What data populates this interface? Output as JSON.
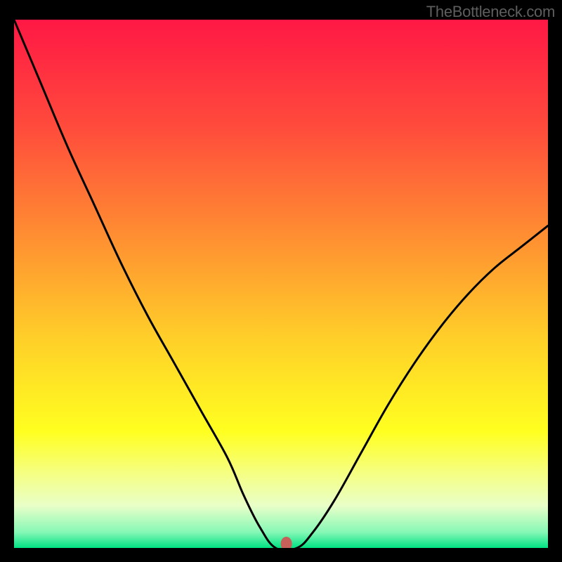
{
  "watermark": "TheBottleneck.com",
  "chart_data": {
    "type": "line",
    "title": "",
    "xlabel": "",
    "ylabel": "",
    "x": [
      0.0,
      0.05,
      0.1,
      0.15,
      0.2,
      0.25,
      0.3,
      0.35,
      0.4,
      0.43,
      0.46,
      0.49,
      0.53,
      0.56,
      0.6,
      0.65,
      0.7,
      0.75,
      0.8,
      0.85,
      0.9,
      0.95,
      1.0
    ],
    "values": [
      1.0,
      0.88,
      0.76,
      0.65,
      0.54,
      0.44,
      0.35,
      0.26,
      0.17,
      0.1,
      0.04,
      0.0,
      0.0,
      0.03,
      0.09,
      0.18,
      0.27,
      0.35,
      0.42,
      0.48,
      0.53,
      0.57,
      0.61
    ],
    "xlim": [
      0,
      1
    ],
    "ylim": [
      0,
      1
    ],
    "marker": {
      "x": 0.51,
      "y": 0.0,
      "color": "#c76058"
    },
    "gradient_stops": [
      {
        "offset": 0.0,
        "color": "#ff1845"
      },
      {
        "offset": 0.2,
        "color": "#ff4a3c"
      },
      {
        "offset": 0.4,
        "color": "#ff8b32"
      },
      {
        "offset": 0.6,
        "color": "#ffce29"
      },
      {
        "offset": 0.78,
        "color": "#ffff20"
      },
      {
        "offset": 0.86,
        "color": "#f5ff84"
      },
      {
        "offset": 0.92,
        "color": "#e9ffc8"
      },
      {
        "offset": 0.97,
        "color": "#86f8b6"
      },
      {
        "offset": 1.0,
        "color": "#00e283"
      }
    ]
  }
}
